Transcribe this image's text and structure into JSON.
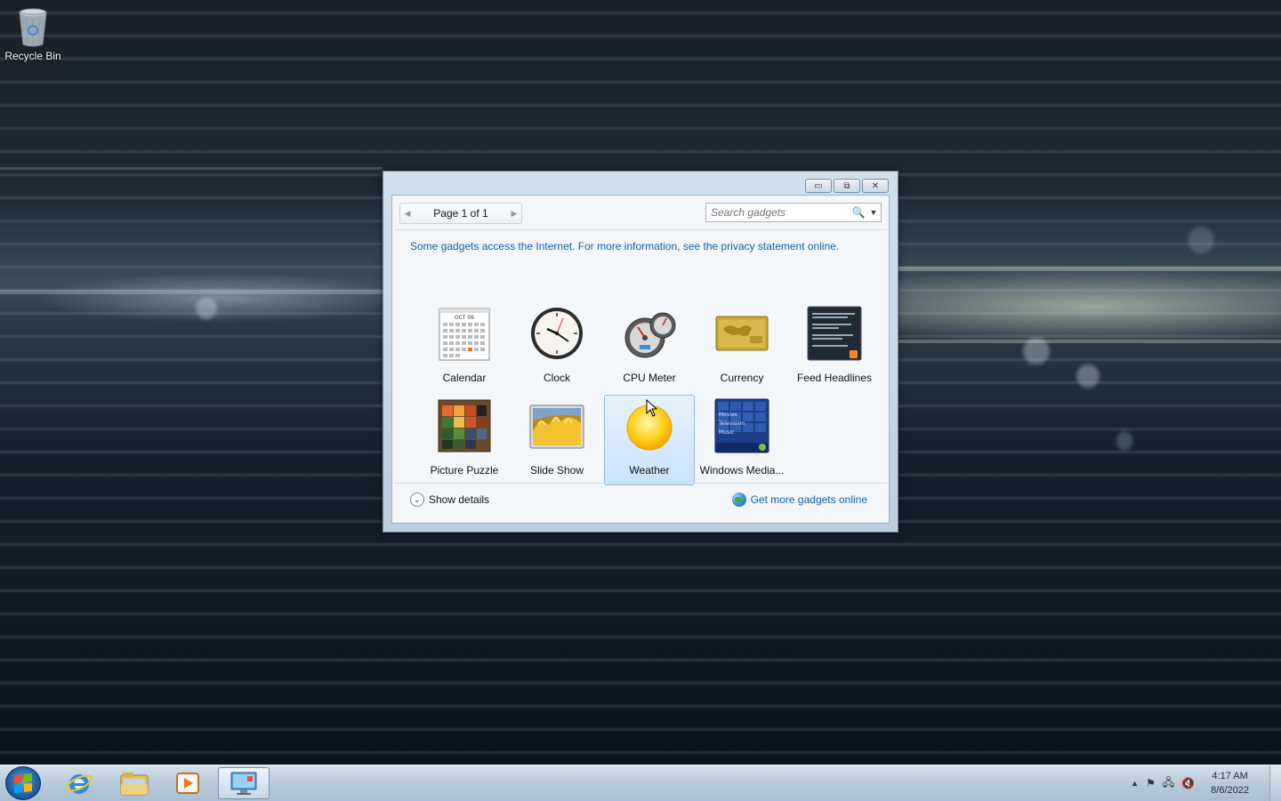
{
  "desktop": {
    "icons": [
      {
        "label": "Recycle Bin",
        "icon": "recycle-bin-icon"
      }
    ]
  },
  "gadget_window": {
    "controls": {
      "minimize": "▭",
      "restore": "⧉",
      "close": "✕"
    },
    "pager": {
      "prev": "◀",
      "next": "▶",
      "text": "Page 1 of 1"
    },
    "search": {
      "placeholder": "Search gadgets",
      "icon": "🔍",
      "dropdown": "▼"
    },
    "notice": "Some gadgets access the Internet.  For more information, see the privacy statement online.",
    "gadgets": [
      {
        "label": "Calendar",
        "icon": "calendar-icon",
        "selected": false
      },
      {
        "label": "Clock",
        "icon": "clock-icon",
        "selected": false
      },
      {
        "label": "CPU Meter",
        "icon": "cpu-meter-icon",
        "selected": false
      },
      {
        "label": "Currency",
        "icon": "currency-icon",
        "selected": false
      },
      {
        "label": "Feed Headlines",
        "icon": "feed-headlines-icon",
        "selected": false
      },
      {
        "label": "Picture Puzzle",
        "icon": "picture-puzzle-icon",
        "selected": false
      },
      {
        "label": "Slide Show",
        "icon": "slide-show-icon",
        "selected": false
      },
      {
        "label": "Weather",
        "icon": "weather-icon",
        "selected": true
      },
      {
        "label": "Windows Media...",
        "icon": "windows-media-center-icon",
        "selected": false
      }
    ],
    "media_tile_lines": [
      "Movies",
      "Television",
      "Music"
    ],
    "calendar_month": "OCT 06",
    "footer": {
      "show_details": "Show details",
      "chevron": "⌄",
      "get_more": "Get more gadgets online"
    }
  },
  "taskbar": {
    "pinned": [
      "internet-explorer-icon",
      "windows-explorer-icon",
      "media-player-icon",
      "desktop-gadgets-icon"
    ],
    "tray": {
      "show_hidden": "▲",
      "flag": "⚑",
      "network": "🖧",
      "volume": "🔇"
    },
    "clock": {
      "time": "4:17 AM",
      "date": "8/6/2022"
    }
  }
}
